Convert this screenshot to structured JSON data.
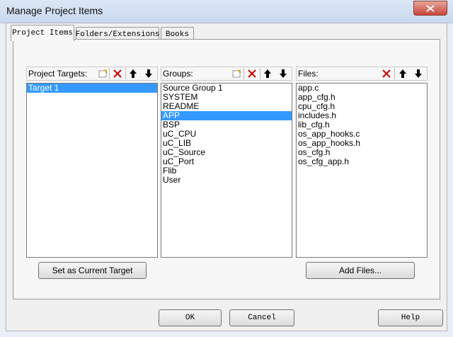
{
  "window": {
    "title": "Manage Project Items"
  },
  "tabs": [
    {
      "label": "Project Items",
      "active": true
    },
    {
      "label": "Folders/Extensions",
      "active": false
    },
    {
      "label": "Books",
      "active": false
    }
  ],
  "targets": {
    "label": "Project Targets:",
    "items": [
      "Target 1"
    ],
    "selected": "Target 1",
    "set_current_button": "Set as Current Target"
  },
  "groups": {
    "label": "Groups:",
    "items": [
      "Source Group 1",
      "SYSTEM",
      "README",
      "APP",
      "BSP",
      "uC_CPU",
      "uC_LIB",
      "uC_Source",
      "uC_Port",
      "Flib",
      "User"
    ],
    "selected": "APP"
  },
  "files": {
    "label": "Files:",
    "items": [
      "app.c",
      "app_cfg.h",
      "cpu_cfg.h",
      "includes.h",
      "lib_cfg.h",
      "os_app_hooks.c",
      "os_app_hooks.h",
      "os_cfg.h",
      "os_cfg_app.h"
    ],
    "add_button": "Add Files..."
  },
  "footer": {
    "ok": "OK",
    "cancel": "Cancel",
    "help": "Help"
  },
  "colors": {
    "selection": "#3399ff",
    "close_button": "#c9473a",
    "delete_icon": "#cc0000"
  }
}
